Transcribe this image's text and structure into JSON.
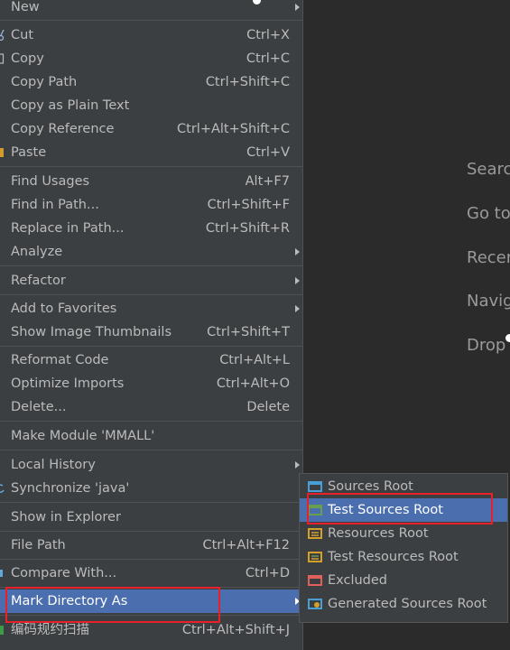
{
  "context_menu": {
    "items": [
      {
        "label": "New",
        "shortcut": "",
        "submenu": true
      },
      {
        "label": "Cut",
        "shortcut": "Ctrl+X"
      },
      {
        "label": "Copy",
        "shortcut": "Ctrl+C"
      },
      {
        "label": "Copy Path",
        "shortcut": "Ctrl+Shift+C"
      },
      {
        "label": "Copy as Plain Text",
        "shortcut": ""
      },
      {
        "label": "Copy Reference",
        "shortcut": "Ctrl+Alt+Shift+C"
      },
      {
        "label": "Paste",
        "shortcut": "Ctrl+V"
      },
      {
        "label": "Find Usages",
        "shortcut": "Alt+F7"
      },
      {
        "label": "Find in Path...",
        "shortcut": "Ctrl+Shift+F"
      },
      {
        "label": "Replace in Path...",
        "shortcut": "Ctrl+Shift+R"
      },
      {
        "label": "Analyze",
        "shortcut": "",
        "submenu": true
      },
      {
        "label": "Refactor",
        "shortcut": "",
        "submenu": true
      },
      {
        "label": "Add to Favorites",
        "shortcut": "",
        "submenu": true
      },
      {
        "label": "Show Image Thumbnails",
        "shortcut": "Ctrl+Shift+T"
      },
      {
        "label": "Reformat Code",
        "shortcut": "Ctrl+Alt+L"
      },
      {
        "label": "Optimize Imports",
        "shortcut": "Ctrl+Alt+O"
      },
      {
        "label": "Delete...",
        "shortcut": "Delete"
      },
      {
        "label": "Make Module 'MMALL'",
        "shortcut": ""
      },
      {
        "label": "Local History",
        "shortcut": "",
        "submenu": true
      },
      {
        "label": "Synchronize 'java'",
        "shortcut": ""
      },
      {
        "label": "Show in Explorer",
        "shortcut": ""
      },
      {
        "label": "File Path",
        "shortcut": "Ctrl+Alt+F12"
      },
      {
        "label": "Compare With...",
        "shortcut": "Ctrl+D"
      },
      {
        "label": "Mark Directory As",
        "shortcut": "",
        "submenu": true,
        "selected": true
      },
      {
        "label": "编码规约扫描",
        "shortcut": "Ctrl+Alt+Shift+J"
      }
    ]
  },
  "submenu": {
    "items": [
      {
        "label": "Sources Root",
        "icon": "sources-root-folder-icon",
        "color": "#4a9ed6"
      },
      {
        "label": "Test Sources Root",
        "icon": "test-sources-root-folder-icon",
        "color": "#6a9e4f",
        "selected": true
      },
      {
        "label": "Resources Root",
        "icon": "resources-root-folder-icon",
        "color": "#d4a02a"
      },
      {
        "label": "Test Resources Root",
        "icon": "test-resources-root-folder-icon",
        "color": "#d4a02a"
      },
      {
        "label": "Excluded",
        "icon": "excluded-folder-icon",
        "color": "#e0605a"
      },
      {
        "label": "Generated Sources Root",
        "icon": "generated-sources-root-folder-icon",
        "color": "#4a9ed6"
      }
    ]
  },
  "editor_hints": [
    "Searc",
    "Go to",
    "Recer",
    "Navig",
    "Drop"
  ],
  "colors": {
    "selection": "#4b6eaf",
    "menu_bg": "#3c3f41",
    "highlight_box": "#e8202a"
  }
}
